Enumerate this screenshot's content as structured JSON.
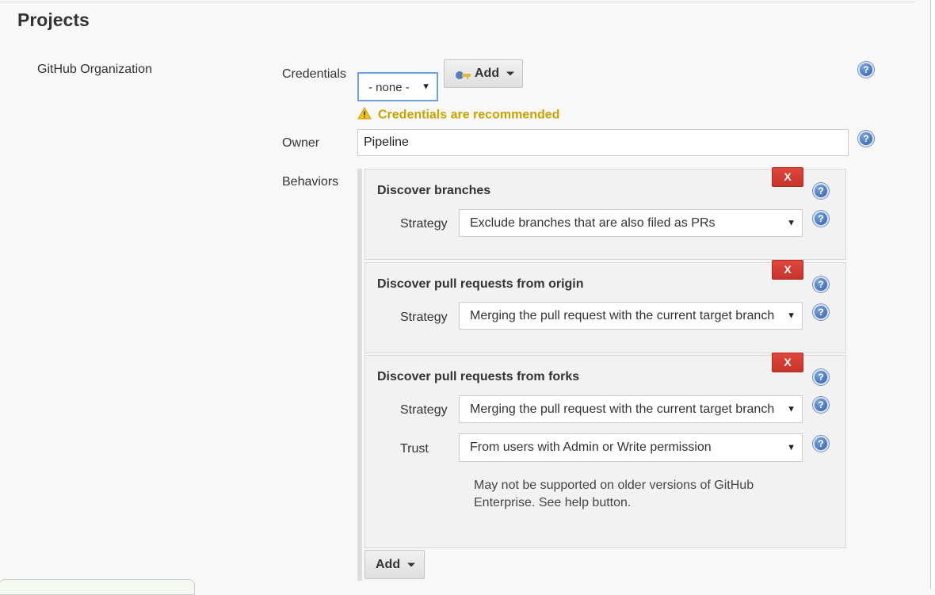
{
  "section": {
    "title": "Projects"
  },
  "org": {
    "label": "GitHub Organization"
  },
  "credentials": {
    "label": "Credentials",
    "selected": "- none -",
    "add_label": "Add",
    "warning": "Credentials are recommended"
  },
  "owner": {
    "label": "Owner",
    "value": "Pipeline"
  },
  "behaviors": {
    "label": "Behaviors",
    "delete_label": "X",
    "cards": [
      {
        "title": "Discover branches",
        "strategy_label": "Strategy",
        "strategy_value": "Exclude branches that are also filed as PRs"
      },
      {
        "title": "Discover pull requests from origin",
        "strategy_label": "Strategy",
        "strategy_value": "Merging the pull request with the current target branch"
      },
      {
        "title": "Discover pull requests from forks",
        "strategy_label": "Strategy",
        "strategy_value": "Merging the pull request with the current target branch",
        "trust_label": "Trust",
        "trust_value": "From users with Admin or Write permission",
        "note": "May not be supported on older versions of GitHub Enterprise. See help button."
      }
    ],
    "add_label": "Add"
  },
  "help_glyph": "?",
  "colors": {
    "warning": "#c9a200",
    "delete": "#d23b32",
    "help": "#3a6bb5"
  },
  "icons": {
    "help": "help-icon",
    "warning": "warning-icon",
    "key": "key-icon",
    "caret": "caret-down-icon"
  }
}
